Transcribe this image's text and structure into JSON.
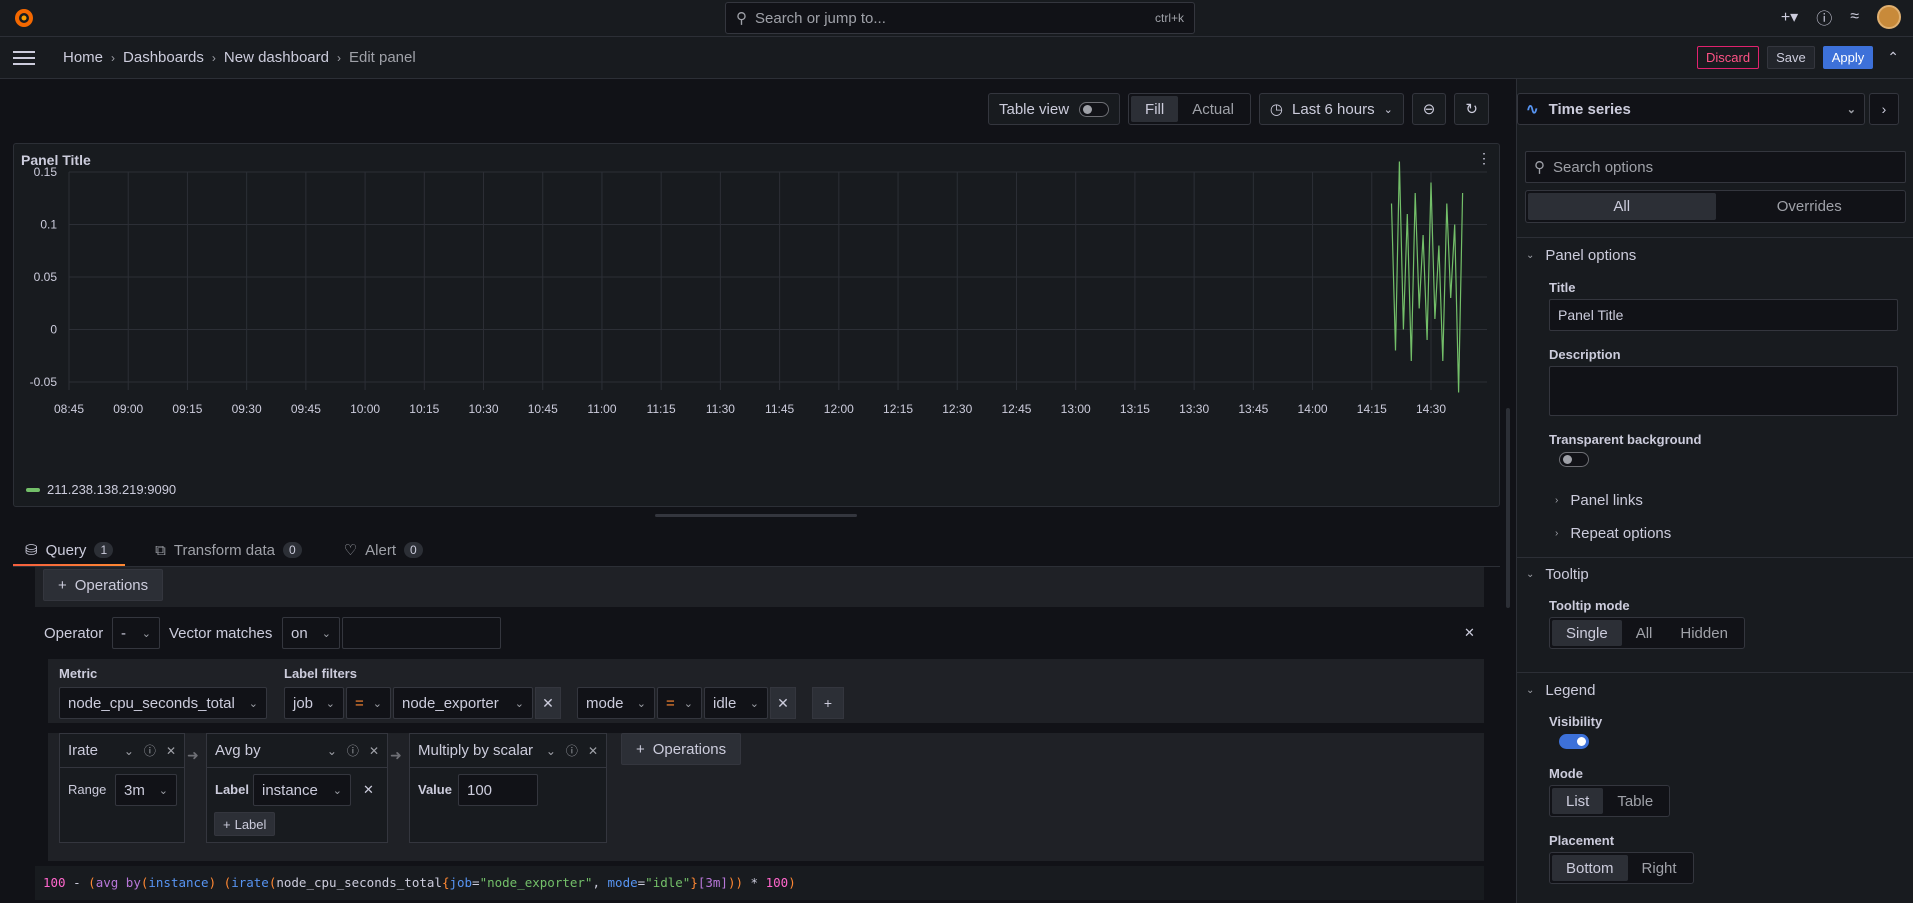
{
  "topbar": {
    "search_placeholder": "Search or jump to...",
    "shortcut": "ctrl+k",
    "icons": [
      "grafana-logo-icon",
      "plus-icon",
      "help-icon",
      "rss-icon",
      "avatar"
    ]
  },
  "nav": {
    "breadcrumb": [
      "Home",
      "Dashboards",
      "New dashboard",
      "Edit panel"
    ],
    "discard": "Discard",
    "save": "Save",
    "apply": "Apply"
  },
  "toolbar": {
    "table_view": "Table view",
    "fill": "Fill",
    "actual": "Actual",
    "time_range": "Last 6 hours"
  },
  "panel": {
    "title": "Panel Title",
    "legend": "211.238.138.219:9090",
    "series_color": "#73bf69"
  },
  "chart_data": {
    "type": "line",
    "title": "Panel Title",
    "x_ticks": [
      "08:45",
      "09:00",
      "09:15",
      "09:30",
      "09:45",
      "10:00",
      "10:15",
      "10:30",
      "10:45",
      "11:00",
      "11:15",
      "11:30",
      "11:45",
      "12:00",
      "12:15",
      "12:30",
      "12:45",
      "13:00",
      "13:15",
      "13:30",
      "13:45",
      "14:00",
      "14:15",
      "14:30"
    ],
    "y_ticks": [
      "0.15",
      "0.1",
      "0.05",
      "0",
      "-0.05"
    ],
    "ylim": [
      -0.05,
      0.15
    ],
    "grid": true,
    "legend_placement": "bottom",
    "series": [
      {
        "name": "211.238.138.219:9090",
        "x": [
          "14:20",
          "14:21",
          "14:22",
          "14:23",
          "14:24",
          "14:25",
          "14:26",
          "14:27",
          "14:28",
          "14:29",
          "14:30",
          "14:31",
          "14:32",
          "14:33",
          "14:34",
          "14:35",
          "14:36",
          "14:37",
          "14:38"
        ],
        "values": [
          0.12,
          -0.02,
          0.16,
          0.0,
          0.11,
          -0.03,
          0.13,
          0.02,
          0.09,
          -0.01,
          0.14,
          0.01,
          0.08,
          -0.03,
          0.12,
          0.03,
          0.1,
          -0.06,
          0.13
        ]
      }
    ]
  },
  "tabs": [
    {
      "label": "Query",
      "count": "1"
    },
    {
      "label": "Transform data",
      "count": "0"
    },
    {
      "label": "Alert",
      "count": "0"
    }
  ],
  "query": {
    "operations_label": "Operations",
    "operator_label": "Operator",
    "operator_value": "-",
    "vector_matches_label": "Vector matches",
    "vector_matches_value": "on",
    "metric_label": "Metric",
    "metric_value": "node_cpu_seconds_total",
    "label_filters_label": "Label filters",
    "filters": [
      {
        "label": "job",
        "op": "=",
        "value": "node_exporter"
      },
      {
        "label": "mode",
        "op": "=",
        "value": "idle"
      }
    ],
    "ops": [
      {
        "name": "Irate",
        "param_label": "Range",
        "param_value": "3m"
      },
      {
        "name": "Avg by",
        "param_label": "Label",
        "param_value": "instance",
        "add_label": "Label"
      },
      {
        "name": "Multiply by scalar",
        "param_label": "Value",
        "param_value": "100"
      }
    ],
    "expression": {
      "p1": "100",
      "p2": " - ",
      "p3": "(",
      "p4": "avg",
      "p5": " by",
      "p6": "(",
      "p7": "instance",
      "p8": ") ",
      "p9": "(",
      "p10": "irate",
      "p11": "(",
      "p12": "node_cpu_seconds_total",
      "p13": "{",
      "p14": "job",
      "p15": "=",
      "p16": "\"node_exporter\"",
      "p17": ", ",
      "p18": "mode",
      "p19": "=",
      "p20": "\"idle\"",
      "p21": "}",
      "p22": "[3m]",
      "p23": "))",
      "p24": " * ",
      "p25": "100",
      "p26": ")"
    }
  },
  "options": {
    "viz": "Time series",
    "search_placeholder": "Search options",
    "all": "All",
    "overrides": "Overrides",
    "panel_options": "Panel options",
    "title_label": "Title",
    "title_value": "Panel Title",
    "description_label": "Description",
    "transparent_label": "Transparent background",
    "panel_links": "Panel links",
    "repeat_options": "Repeat options",
    "tooltip": "Tooltip",
    "tooltip_mode_label": "Tooltip mode",
    "tooltip_modes": [
      "Single",
      "All",
      "Hidden"
    ],
    "legend": "Legend",
    "visibility_label": "Visibility",
    "mode_label": "Mode",
    "modes": [
      "List",
      "Table"
    ],
    "placement_label": "Placement",
    "placements": [
      "Bottom",
      "Right"
    ]
  }
}
